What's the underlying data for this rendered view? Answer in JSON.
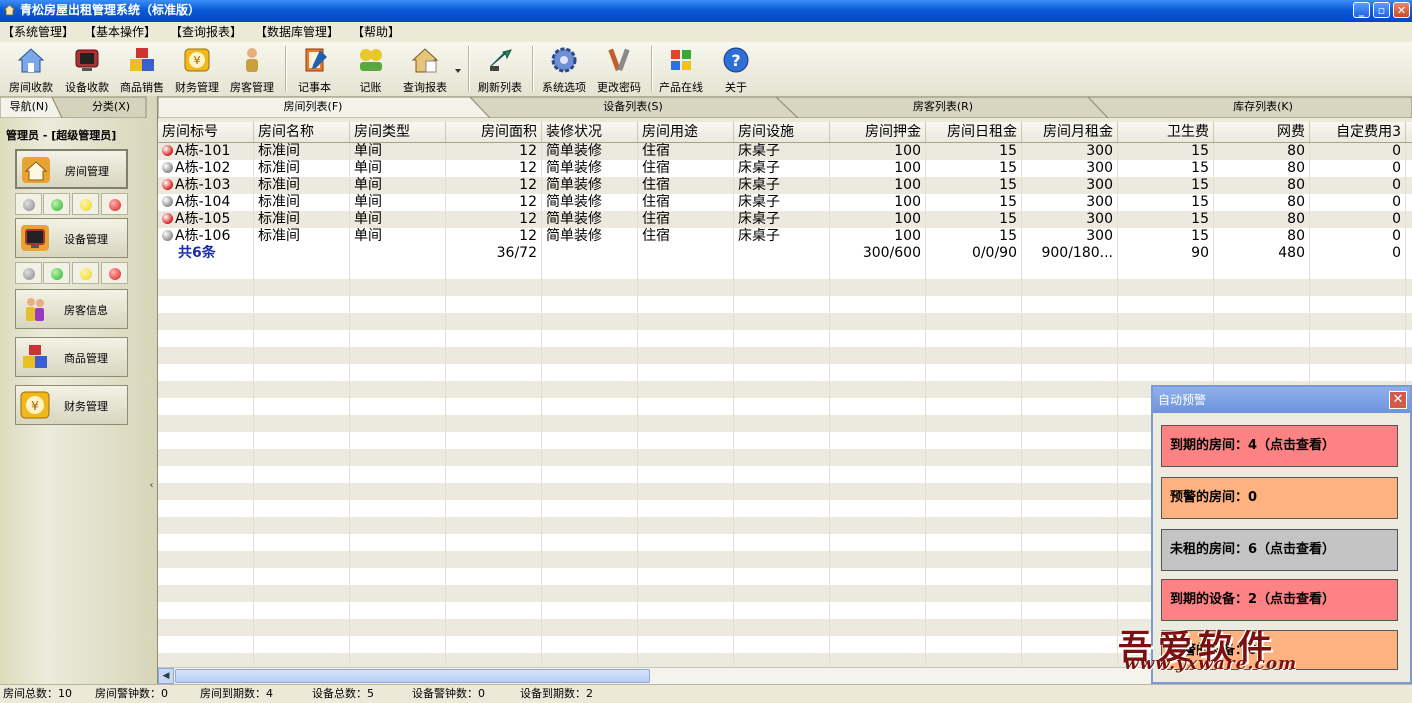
{
  "window": {
    "title": "青松房屋出租管理系统（标准版）",
    "minimize": "_",
    "maximize": "▫",
    "close": "✕"
  },
  "menu": [
    "【系统管理】",
    "【基本操作】",
    "【查询报表】",
    "【数据库管理】",
    "【帮助】"
  ],
  "toolbar": {
    "room_checkout": "房间收款",
    "device_checkout": "设备收款",
    "goods_sales": "商品销售",
    "finance": "财务管理",
    "tenant": "房客管理",
    "notepad": "记事本",
    "bookkeeping": "记账",
    "reports": "查询报表",
    "refresh": "刷新列表",
    "options": "系统选项",
    "password": "更改密码",
    "online": "产品在线",
    "about": "关于"
  },
  "sidebar": {
    "tab_nav": "导航(N)",
    "tab_category": "分类(X)",
    "admin": "管理员 - [超级管理员]",
    "items": {
      "room": "房间管理",
      "device": "设备管理",
      "tenant": "房客信息",
      "goods": "商品管理",
      "finance": "财务管理"
    },
    "colors": {
      "gray": "#8a8a8a",
      "green": "#22b522",
      "yellow": "#e9d51b",
      "red": "#d81e1e"
    }
  },
  "tabs": [
    "房间列表(F)",
    "设备列表(S)",
    "房客列表(R)",
    "库存列表(K)"
  ],
  "table": {
    "columns": [
      "房间标号",
      "房间名称",
      "房间类型",
      "房间面积",
      "装修状况",
      "房间用途",
      "房间设施",
      "房间押金",
      "房间日租金",
      "房间月租金",
      "卫生费",
      "网费",
      "自定费用3"
    ],
    "rows": [
      {
        "status": "red",
        "cells": [
          "A栋-101",
          "标准间",
          "单间",
          "12",
          "简单装修",
          "住宿",
          "床桌子",
          "100",
          "15",
          "300",
          "15",
          "80",
          "0"
        ]
      },
      {
        "status": "gray",
        "cells": [
          "A栋-102",
          "标准间",
          "单间",
          "12",
          "简单装修",
          "住宿",
          "床桌子",
          "100",
          "15",
          "300",
          "15",
          "80",
          "0"
        ]
      },
      {
        "status": "red",
        "cells": [
          "A栋-103",
          "标准间",
          "单间",
          "12",
          "简单装修",
          "住宿",
          "床桌子",
          "100",
          "15",
          "300",
          "15",
          "80",
          "0"
        ]
      },
      {
        "status": "gray",
        "cells": [
          "A栋-104",
          "标准间",
          "单间",
          "12",
          "简单装修",
          "住宿",
          "床桌子",
          "100",
          "15",
          "300",
          "15",
          "80",
          "0"
        ]
      },
      {
        "status": "red",
        "cells": [
          "A栋-105",
          "标准间",
          "单间",
          "12",
          "简单装修",
          "住宿",
          "床桌子",
          "100",
          "15",
          "300",
          "15",
          "80",
          "0"
        ]
      },
      {
        "status": "gray",
        "cells": [
          "A栋-106",
          "标准间",
          "单间",
          "12",
          "简单装修",
          "住宿",
          "床桌子",
          "100",
          "15",
          "300",
          "15",
          "80",
          "0"
        ]
      }
    ],
    "summary": [
      "共6条",
      "",
      "",
      "36/72",
      "",
      "",
      "",
      "300/600",
      "0/0/90",
      "900/180...",
      "90",
      "480",
      "0"
    ]
  },
  "status_bar": {
    "rooms_total": "房间总数：10",
    "rooms_alarm": "房间警钟数：0",
    "rooms_due": "房间到期数：4",
    "devices_total": "设备总数：5",
    "devices_alarm": "设备警钟数：0",
    "devices_due": "设备到期数：2"
  },
  "popup": {
    "title": "自动预警",
    "close": "✕",
    "items": [
      {
        "text": "到期的房间：4（点击查看）",
        "color": "#fd8283"
      },
      {
        "text": "预警的房间：0",
        "color": "#fdb27f"
      },
      {
        "text": "未租的房间：6（点击查看）",
        "color": "#c4c4c4"
      },
      {
        "text": "到期的设备：2（点击查看）",
        "color": "#fd8283"
      },
      {
        "text": "预警的设备：0",
        "color": "#fdb27f"
      }
    ]
  },
  "watermark": {
    "line1": "吾爱软件",
    "line2": "www.yxware.com"
  }
}
